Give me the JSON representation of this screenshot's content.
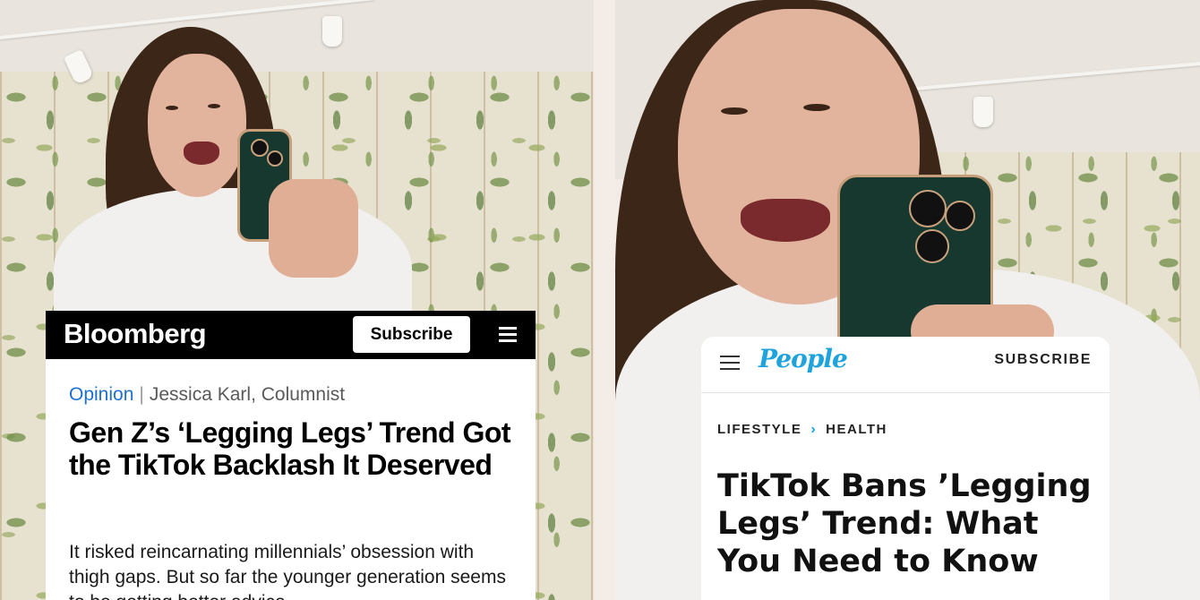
{
  "bloomberg": {
    "logo": "Bloomberg",
    "subscribe_label": "Subscribe",
    "menu_icon": "hamburger-menu-icon",
    "section": "Opinion",
    "separator": "|",
    "author": "Jessica Karl, Columnist",
    "headline": "Gen Z’s ‘Legging Legs’ Trend Got the TikTok Backlash It Deserved",
    "dek": "It risked reincarnating millennials’ obsession with thigh gaps. But so far the younger generation seems to be getting better advice"
  },
  "people": {
    "logo": "People",
    "subscribe_label": "SUBSCRIBE",
    "menu_icon": "hamburger-menu-icon",
    "breadcrumb": [
      "LIFESTYLE",
      "HEALTH"
    ],
    "breadcrumb_separator": "›",
    "headline": "TikTok Bans ’Legging Legs’ Trend: What You Need to Know"
  },
  "colors": {
    "bloomberg_bar": "#000000",
    "bloomberg_section": "#1f6fd0",
    "people_brand": "#1ea3dc",
    "wallpaper": "#e7e2cf"
  }
}
